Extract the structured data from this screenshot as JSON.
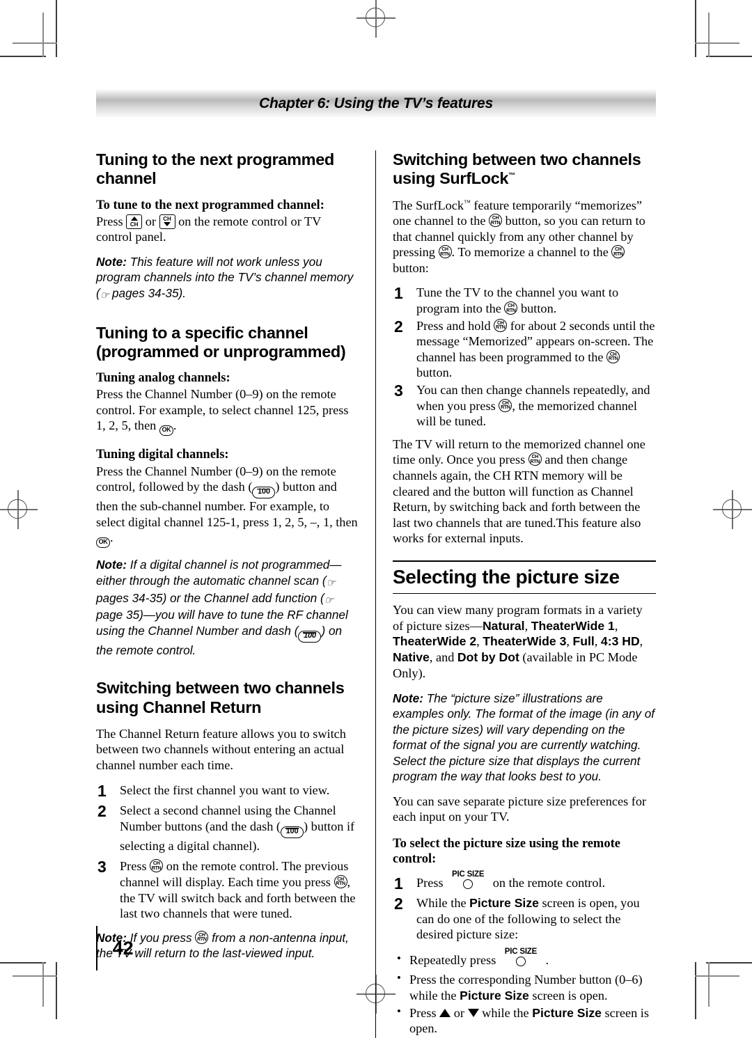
{
  "header": {
    "chapter_banner": "Chapter 6: Using the TV’s features"
  },
  "page_number": "42",
  "left_column": {
    "section1": {
      "heading": "Tuning to the next programmed channel",
      "subheading": "To tune to the next programmed channel:",
      "body_pre": "Press ",
      "body_mid": " or ",
      "body_post": " on the remote control or TV control panel.",
      "note_label": "Note:",
      "note_text": " This feature will not work unless you program channels into the TV’s channel memory (",
      "note_text_end": " pages 34-35)."
    },
    "section2": {
      "heading": "Tuning to a specific channel (programmed or unprogrammed)",
      "analog_subheading": "Tuning analog channels:",
      "analog_body_pre": "Press the Channel Number (0–9) on the remote control. For example, to select channel 125, press 1, 2, 5, then ",
      "analog_body_post": ".",
      "digital_subheading": "Tuning digital channels:",
      "digital_body_pre": "Press the Channel Number (0–9) on the remote control, followed by the dash (",
      "digital_body_mid": ") button and then the sub-channel number. For example, to select digital channel 125-1, press 1, 2, 5, –, 1, then ",
      "digital_body_post": ".",
      "note_label": "Note:",
      "note_p1": " If a digital channel is not programmed—either through the automatic channel scan (",
      "note_p2": " pages 34-35) or the Channel add function (",
      "note_p3": " page 35)—you will have to tune the RF channel using the Channel Number and dash (",
      "note_p4": ") on the remote control."
    },
    "section3": {
      "heading": "Switching between two channels using Channel Return",
      "intro": "The Channel Return feature allows you to switch between two channels without entering an actual channel number each time.",
      "steps": [
        {
          "num": "1",
          "text": "Select the first channel you want to view."
        },
        {
          "num": "2",
          "pre": "Select a second channel using the Channel Number buttons (and the dash (",
          "post": ") button if selecting a digital channel)."
        },
        {
          "num": "3",
          "pre": "Press ",
          "mid": " on the remote control. The previous channel will display. Each time you press ",
          "post": ", the TV will switch back and forth between the last two channels that were tuned."
        }
      ],
      "note_label": "Note:",
      "note_pre": " If you press ",
      "note_post": " from a non-antenna input, the TV will return to the last-viewed input."
    }
  },
  "right_column": {
    "section1": {
      "heading": "Switching between two channels using SurfLock",
      "heading_tm": "™",
      "intro_pre": "The SurfLock",
      "intro_tm": "™",
      "intro_a": " feature temporarily “memorizes” one channel to the ",
      "intro_b": " button, so you can return to that channel quickly from any other channel by pressing ",
      "intro_c": ". To memorize a channel to the ",
      "intro_d": " button:",
      "steps": [
        {
          "num": "1",
          "pre": "Tune the TV to the channel you want to program into the ",
          "post": " button."
        },
        {
          "num": "2",
          "pre": "Press and hold ",
          "mid": " for about 2 seconds until the message “Memorized” appears on-screen. The channel has been programmed to the ",
          "post": " button."
        },
        {
          "num": "3",
          "pre": "You can then change channels repeatedly, and when you press ",
          "post": ", the memorized channel will be tuned."
        }
      ],
      "outro_pre": "The TV will return to the memorized channel one time only. Once you press ",
      "outro_post": " and then change channels again, the CH RTN memory will be cleared and the button will function as Channel Return, by switching back and forth between the last two channels that are tuned.This feature also works for external inputs."
    },
    "section2": {
      "heading": "Selecting the picture size",
      "intro_pre": "You can view many program formats in a variety of picture sizes—",
      "sizes": [
        "Natural",
        "TheaterWide 1",
        "TheaterWide 2",
        "TheaterWide 3",
        "Full",
        "4:3 HD",
        "Native",
        "Dot by Dot"
      ],
      "intro_and": ", and ",
      "intro_post": " (available in PC Mode Only).",
      "note_label": "Note:",
      "note_text": " The “picture size” illustrations are examples only. The format of the image (in any of the picture sizes) will vary depending on the format of the signal you are currently watching. Select the picture size that displays the current program the way that looks best to you.",
      "save_text": "You can save separate picture size preferences for each input on your TV.",
      "remote_subheading": "To select the picture size using the remote control:",
      "steps": [
        {
          "num": "1",
          "pre": "Press ",
          "post": " on the remote control."
        },
        {
          "num": "2",
          "pre": "While the ",
          "bold": "Picture Size",
          "post": " screen is open, you can do one of the following to select the desired picture size:"
        }
      ],
      "bullets": [
        {
          "pre": "Repeatedly press ",
          "post": " ."
        },
        {
          "pre": "Press the corresponding Number button (0–6) while the ",
          "bold": "Picture Size",
          "post": " screen is open."
        },
        {
          "pre": "Press ",
          "mid": " or ",
          "bold": "Picture Size",
          "post": " screen is open.",
          "while": " while the "
        }
      ]
    }
  },
  "buttons": {
    "ch_rtn": {
      "line1": "CH",
      "line2": "RTN"
    },
    "ok": "OK",
    "dash_100": "100",
    "ch_up": "CH",
    "ch_down": "CH",
    "pic_size": "PIC SIZE"
  },
  "colors": {
    "text": "#000000",
    "banner_gray": "#b9b9b9",
    "rule": "#000000",
    "crop_mark": "#3a3a3a"
  }
}
